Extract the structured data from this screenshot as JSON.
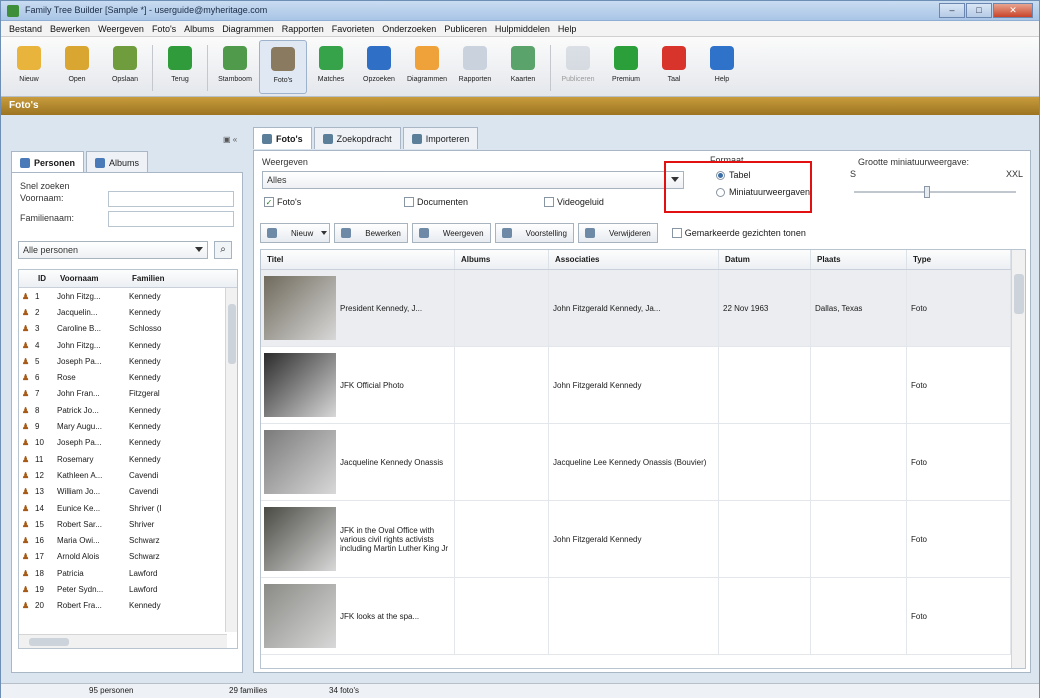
{
  "window": {
    "title": "Family Tree Builder [Sample *] - userguide@myheritage.com",
    "controls": [
      "–",
      "□",
      "✕"
    ]
  },
  "menu": [
    "Bestand",
    "Bewerken",
    "Weergeven",
    "Foto's",
    "Albums",
    "Diagrammen",
    "Rapporten",
    "Favorieten",
    "Onderzoeken",
    "Publiceren",
    "Hulpmiddelen",
    "Help"
  ],
  "toolbar": {
    "items": [
      {
        "label": "Nieuw",
        "color": "#e8b43c"
      },
      {
        "label": "Open",
        "color": "#d9a631"
      },
      {
        "label": "Opslaan",
        "color": "#6f9c3d"
      },
      {
        "label": "Terug",
        "color": "#2f9b3b"
      },
      {
        "label": "Stamboom",
        "color": "#4f9a4b"
      },
      {
        "label": "Foto's",
        "color": "#8a7a5f"
      },
      {
        "label": "Matches",
        "color": "#36a34a"
      },
      {
        "label": "Opzoeken",
        "color": "#2f6fc5"
      },
      {
        "label": "Diagrammen",
        "color": "#f0a23a"
      },
      {
        "label": "Rapporten",
        "color": "#c9d2dd"
      },
      {
        "label": "Kaarten",
        "color": "#5aa36a"
      },
      {
        "label": "Publiceren",
        "color": "#b8c2cf"
      },
      {
        "label": "Premium",
        "color": "#2a9f3a"
      },
      {
        "label": "Taal",
        "color": "#d9342b"
      },
      {
        "label": "Help",
        "color": "#2f72c9"
      }
    ]
  },
  "section_title": "Foto's",
  "left": {
    "collapse": "▣ «",
    "tabs": [
      {
        "label": "Personen"
      },
      {
        "label": "Albums"
      }
    ],
    "quick_search": "Snel zoeken",
    "first_name_label": "Voornaam:",
    "last_name_label": "Familienaam:",
    "filter": "Alle personen",
    "columns": [
      "ID",
      "Voornaam",
      "Familien"
    ],
    "people": [
      {
        "id": "1",
        "first": "John Fitzg...",
        "last": "Kennedy"
      },
      {
        "id": "2",
        "first": "Jacquelin...",
        "last": "Kennedy"
      },
      {
        "id": "3",
        "first": "Caroline B...",
        "last": "Schlosso"
      },
      {
        "id": "4",
        "first": "John Fitzg...",
        "last": "Kennedy"
      },
      {
        "id": "5",
        "first": "Joseph Pa...",
        "last": "Kennedy"
      },
      {
        "id": "6",
        "first": "Rose",
        "last": "Kennedy"
      },
      {
        "id": "7",
        "first": "John Fran...",
        "last": "Fitzgeral"
      },
      {
        "id": "8",
        "first": "Patrick Jo...",
        "last": "Kennedy"
      },
      {
        "id": "9",
        "first": "Mary Augu...",
        "last": "Kennedy"
      },
      {
        "id": "10",
        "first": "Joseph Pa...",
        "last": "Kennedy"
      },
      {
        "id": "11",
        "first": "Rosemary",
        "last": "Kennedy"
      },
      {
        "id": "12",
        "first": "Kathleen A...",
        "last": "Cavendi"
      },
      {
        "id": "13",
        "first": "William Jo...",
        "last": "Cavendi"
      },
      {
        "id": "14",
        "first": "Eunice Ke...",
        "last": "Shriver (I"
      },
      {
        "id": "15",
        "first": "Robert Sar...",
        "last": "Shriver"
      },
      {
        "id": "16",
        "first": "Maria Owi...",
        "last": "Schwarz"
      },
      {
        "id": "17",
        "first": "Arnold Alois",
        "last": "Schwarz"
      },
      {
        "id": "18",
        "first": "Patricia",
        "last": "Lawford"
      },
      {
        "id": "19",
        "first": "Peter Sydn...",
        "last": "Lawford"
      },
      {
        "id": "20",
        "first": "Robert Fra...",
        "last": "Kennedy"
      }
    ]
  },
  "right": {
    "tabs": [
      {
        "label": "Foto's"
      },
      {
        "label": "Zoekopdracht"
      },
      {
        "label": "Importeren"
      }
    ],
    "view_label": "Weergeven",
    "view_value": "Alles",
    "checks": [
      {
        "label": "Foto's",
        "checked": true
      },
      {
        "label": "Documenten",
        "checked": false
      },
      {
        "label": "Videogeluid",
        "checked": false
      }
    ],
    "format_label": "Formaat",
    "format_options": [
      {
        "label": "Tabel",
        "selected": true
      },
      {
        "label": "Miniatuurweergaven",
        "selected": false
      }
    ],
    "thumb_size_label": "Grootte miniatuurweergave:",
    "thumb_size_min": "S",
    "thumb_size_max": "XXL",
    "thumb_size_level": 0.45,
    "actions": [
      {
        "label": "Nieuw"
      },
      {
        "label": "Bewerken"
      },
      {
        "label": "Weergeven"
      },
      {
        "label": "Voorstelling"
      },
      {
        "label": "Verwijderen"
      }
    ],
    "show_marked": "Gemarkeerde gezichten tonen",
    "columns": [
      "Titel",
      "Albums",
      "Associaties",
      "Datum",
      "Plaats",
      "Type"
    ],
    "photos": [
      {
        "title": "President Kennedy, J...",
        "albums": "",
        "assoc": "John Fitzgerald Kennedy, Ja...",
        "date": "22 Nov 1963",
        "place": "Dallas, Texas",
        "type": "Foto"
      },
      {
        "title": "JFK Official Photo",
        "albums": "",
        "assoc": "John Fitzgerald Kennedy",
        "date": "",
        "place": "",
        "type": "Foto"
      },
      {
        "title": "Jacqueline Kennedy Onassis",
        "albums": "",
        "assoc": "Jacqueline Lee Kennedy Onassis (Bouvier)",
        "date": "",
        "place": "",
        "type": "Foto"
      },
      {
        "title": "JFK in the Oval Office with various civil rights activists including Martin Luther King Jr",
        "albums": "",
        "assoc": "John Fitzgerald Kennedy",
        "date": "",
        "place": "",
        "type": "Foto"
      },
      {
        "title": "JFK looks at the spa...",
        "albums": "",
        "assoc": "",
        "date": "",
        "place": "",
        "type": "Foto"
      }
    ]
  },
  "status": {
    "persons": "95 personen",
    "families": "29 families",
    "photos": "34 foto's"
  }
}
